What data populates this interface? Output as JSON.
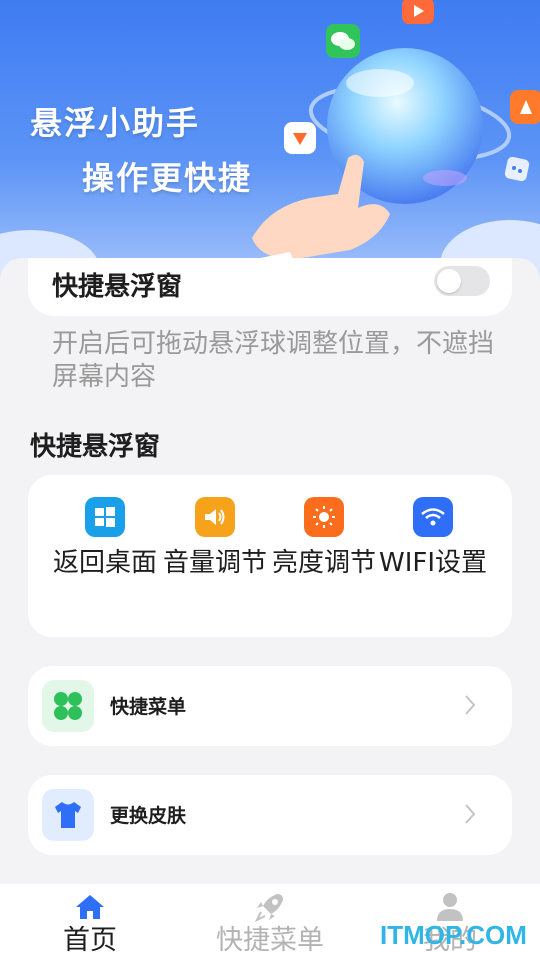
{
  "banner": {
    "line1": "悬浮小助手",
    "line2": "操作更快捷"
  },
  "floating_toggle": {
    "label": "快捷悬浮窗",
    "enabled": false,
    "description": "开启后可拖动悬浮球调整位置，不遮挡屏幕内容"
  },
  "section": {
    "title": "快捷悬浮窗"
  },
  "quick_actions": [
    {
      "label": "返回桌面",
      "icon": "windows-icon",
      "color": "#1aa0e8"
    },
    {
      "label": "音量调节",
      "icon": "speaker-icon",
      "color": "#f7a21b"
    },
    {
      "label": "亮度调节",
      "icon": "sun-icon",
      "color": "#fb6c1c"
    },
    {
      "label": "WIFI设置",
      "icon": "wifi-icon",
      "color": "#2f6ef6"
    }
  ],
  "menu_rows": [
    {
      "label": "快捷菜单",
      "icon": "clover-icon",
      "color": "#2ec15a"
    },
    {
      "label": "更换皮肤",
      "icon": "tshirt-icon",
      "color": "#2f6ef6"
    }
  ],
  "bottom_nav": [
    {
      "label": "首页",
      "icon": "home-icon",
      "active": true
    },
    {
      "label": "快捷菜单",
      "icon": "rocket-icon",
      "active": false
    },
    {
      "label": "我的",
      "icon": "user-icon",
      "active": false
    }
  ],
  "watermark": "ITMOP.COM",
  "colors": {
    "accent": "#2f6ef6",
    "inactive": "#b3b3b3",
    "banner_top": "#3f7cf2"
  }
}
